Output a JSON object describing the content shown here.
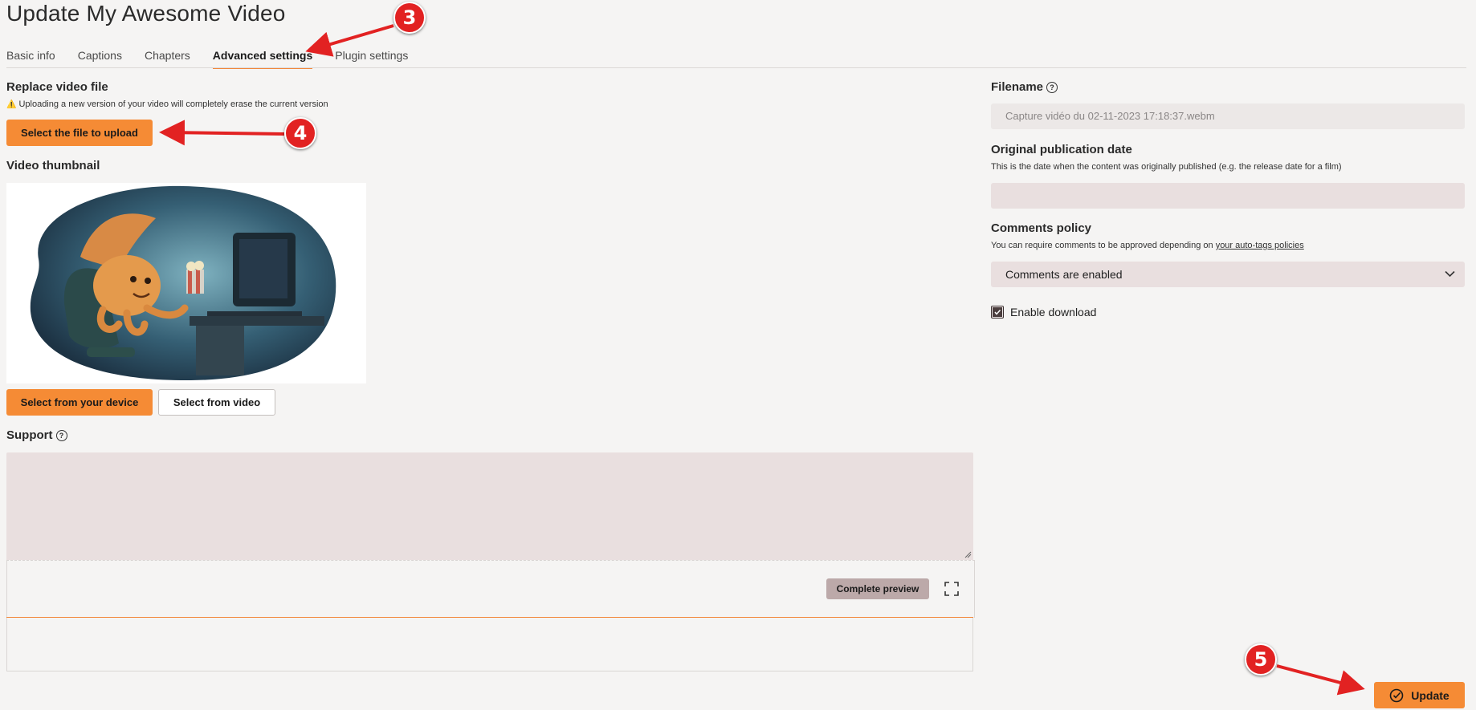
{
  "page": {
    "title": "Update My Awesome Video"
  },
  "tabs": [
    {
      "label": "Basic info"
    },
    {
      "label": "Captions"
    },
    {
      "label": "Chapters"
    },
    {
      "label": "Advanced settings"
    },
    {
      "label": "Plugin settings"
    }
  ],
  "replace": {
    "heading": "Replace video file",
    "warning_icon": "⚠️",
    "warning": "Uploading a new version of your video will completely erase the current version",
    "upload_button": "Select the file to upload"
  },
  "thumbnail": {
    "heading": "Video thumbnail",
    "from_device": "Select from your device",
    "from_video": "Select from video"
  },
  "support": {
    "heading": "Support",
    "preview_button": "Complete preview"
  },
  "filename": {
    "label": "Filename",
    "value": "Capture vidéo du 02-11-2023 17:18:37.webm"
  },
  "pubdate": {
    "label": "Original publication date",
    "help": "This is the date when the content was originally published (e.g. the release date for a film)",
    "value": ""
  },
  "comments": {
    "label": "Comments policy",
    "help_prefix": "You can require comments to be approved depending on ",
    "help_link": "your auto-tags policies",
    "selected": "Comments are enabled"
  },
  "download": {
    "label": "Enable download",
    "checked": true
  },
  "update_button": "Update",
  "annotations": [
    "3",
    "4",
    "5"
  ],
  "colors": {
    "accent": "#f58b35",
    "field": "#e9dfdf",
    "annotation": "#e22222"
  }
}
